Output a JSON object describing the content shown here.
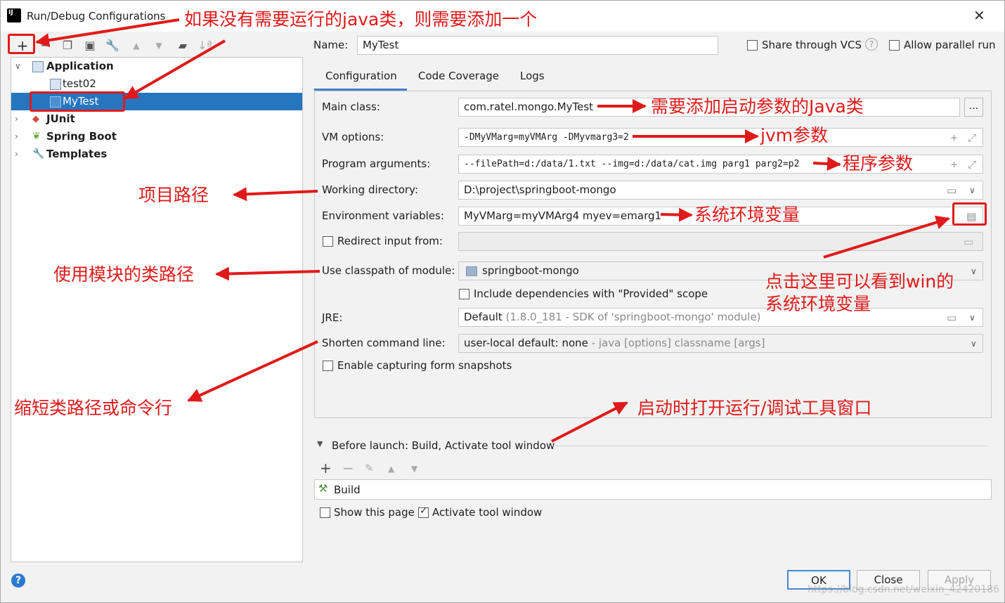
{
  "window": {
    "title": "Run/Debug Configurations",
    "app_icon_text": "IJ"
  },
  "tree": {
    "items": [
      {
        "label": "Application"
      },
      {
        "label": "test02"
      },
      {
        "label": "MyTest"
      },
      {
        "label": "JUnit"
      },
      {
        "label": "Spring Boot"
      },
      {
        "label": "Templates"
      }
    ]
  },
  "header": {
    "name_label": "Name:",
    "name_value": "MyTest",
    "share_vcs": "Share through VCS",
    "allow_parallel": "Allow parallel run"
  },
  "tabs": [
    "Configuration",
    "Code Coverage",
    "Logs"
  ],
  "form": {
    "main_class_label": "Main class:",
    "main_class_value": "com.ratel.mongo.MyTest",
    "main_class_btn": "...",
    "vm_label": "VM options:",
    "vm_value": "-DMyVMarg=myVMArg -DMyvmarg3=2",
    "prog_label": "Program arguments:",
    "prog_value": "--filePath=d:/data/1.txt --img=d:/data/cat.img  parg1 parg2=p2",
    "wd_label": "Working directory:",
    "wd_value": "D:\\project\\springboot-mongo",
    "env_label": "Environment variables:",
    "env_value": "MyVMarg=myVMArg4  myev=emarg1",
    "redirect_label": "Redirect input from:",
    "classpath_label": "Use classpath of module:",
    "classpath_value": "springboot-mongo",
    "include_deps": "Include dependencies with \"Provided\" scope",
    "jre_label": "JRE:",
    "jre_value": "Default",
    "jre_detail": "(1.8.0_181 - SDK of 'springboot-mongo' module)",
    "shorten_label": "Shorten command line:",
    "shorten_value": "user-local default: none",
    "shorten_detail": "- java [options] classname [args]",
    "snapshots": "Enable capturing form snapshots"
  },
  "before_launch": {
    "title": "Before launch: Build, Activate tool window",
    "task": "Build",
    "show_page": "Show this page",
    "activate_tool": "Activate tool window"
  },
  "buttons": {
    "ok": "OK",
    "close": "Close",
    "apply": "Apply",
    "help": "?"
  },
  "annotations": {
    "add_class": "如果没有需要运行的java类，则需要添加一个",
    "main_class": "需要添加启动参数的Java类",
    "jvm": "jvm参数",
    "program": "程序参数",
    "workdir": "项目路径",
    "env": "系统环境变量",
    "classpath": "使用模块的类路径",
    "click_here_1": "点击这里可以看到win的",
    "click_here_2": "系统环境变量",
    "shorten": "缩短类路径或命令行",
    "activate": "启动时打开运行/调试工具窗口"
  },
  "watermark": "https://blog.csdn.net/weixin_42420186",
  "colors": {
    "accent": "#2675bf",
    "annotation": "#e01a1a"
  }
}
